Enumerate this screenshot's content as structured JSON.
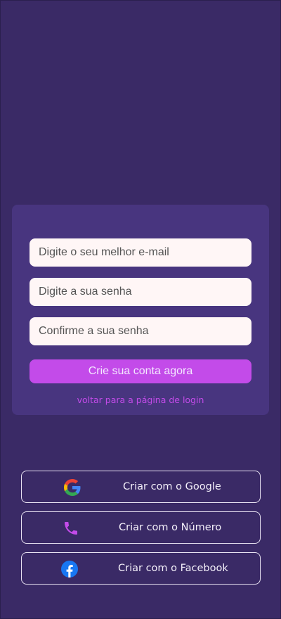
{
  "signup_form": {
    "email_placeholder": "Digite o seu melhor e-mail",
    "password_placeholder": "Digite a sua senha",
    "confirm_placeholder": "Confirme a sua senha",
    "submit_label": "Crie sua conta agora",
    "back_link": "voltar para a página de login"
  },
  "social_signup": [
    {
      "label": "Criar com o Google",
      "icon": "google-icon"
    },
    {
      "label": "Criar com o Número",
      "icon": "phone-icon"
    },
    {
      "label": "Criar com o Facebook",
      "icon": "facebook-icon"
    }
  ],
  "colors": {
    "background": "#3a2a66",
    "card": "#48357f",
    "input_background": "#fff6f6",
    "accent": "#c34be9",
    "facebook_blue": "#1877f2"
  }
}
